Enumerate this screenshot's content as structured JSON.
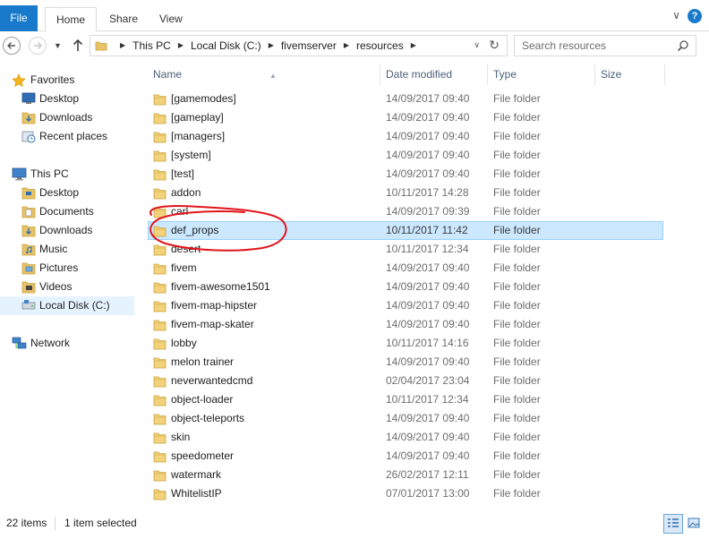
{
  "ribbon": {
    "tabs": [
      "File",
      "Home",
      "Share",
      "View"
    ],
    "minimize_glyph": "∨",
    "help_glyph": "?"
  },
  "address": {
    "breadcrumbs": [
      "This PC",
      "Local Disk (C:)",
      "fivemserver",
      "resources"
    ],
    "separator": "▶",
    "dropdown_glyph": "∨",
    "refresh_glyph": "↻",
    "recent_glyph": "▼"
  },
  "search": {
    "placeholder": "Search resources"
  },
  "navpane": {
    "favorites": {
      "label": "Favorites",
      "items": [
        "Desktop",
        "Downloads",
        "Recent places"
      ]
    },
    "thispc": {
      "label": "This PC",
      "items": [
        "Desktop",
        "Documents",
        "Downloads",
        "Music",
        "Pictures",
        "Videos",
        "Local Disk (C:)"
      ]
    },
    "network": {
      "label": "Network"
    }
  },
  "columns": {
    "name": "Name",
    "date": "Date modified",
    "type": "Type",
    "size": "Size",
    "sort_glyph": "▲"
  },
  "files": [
    {
      "name": "[gamemodes]",
      "date": "14/09/2017 09:40",
      "type": "File folder"
    },
    {
      "name": "[gameplay]",
      "date": "14/09/2017 09:40",
      "type": "File folder"
    },
    {
      "name": "[managers]",
      "date": "14/09/2017 09:40",
      "type": "File folder"
    },
    {
      "name": "[system]",
      "date": "14/09/2017 09:40",
      "type": "File folder"
    },
    {
      "name": "[test]",
      "date": "14/09/2017 09:40",
      "type": "File folder"
    },
    {
      "name": "addon",
      "date": "10/11/2017 14:28",
      "type": "File folder"
    },
    {
      "name": "carl",
      "date": "14/09/2017 09:39",
      "type": "File folder"
    },
    {
      "name": "def_props",
      "date": "10/11/2017 11:42",
      "type": "File folder",
      "selected": true
    },
    {
      "name": "desert",
      "date": "10/11/2017 12:34",
      "type": "File folder"
    },
    {
      "name": "fivem",
      "date": "14/09/2017 09:40",
      "type": "File folder"
    },
    {
      "name": "fivem-awesome1501",
      "date": "14/09/2017 09:40",
      "type": "File folder"
    },
    {
      "name": "fivem-map-hipster",
      "date": "14/09/2017 09:40",
      "type": "File folder"
    },
    {
      "name": "fivem-map-skater",
      "date": "14/09/2017 09:40",
      "type": "File folder"
    },
    {
      "name": "lobby",
      "date": "10/11/2017 14:16",
      "type": "File folder"
    },
    {
      "name": "melon trainer",
      "date": "14/09/2017 09:40",
      "type": "File folder"
    },
    {
      "name": "neverwantedcmd",
      "date": "02/04/2017 23:04",
      "type": "File folder"
    },
    {
      "name": "object-loader",
      "date": "10/11/2017 12:34",
      "type": "File folder"
    },
    {
      "name": "object-teleports",
      "date": "14/09/2017 09:40",
      "type": "File folder"
    },
    {
      "name": "skin",
      "date": "14/09/2017 09:40",
      "type": "File folder"
    },
    {
      "name": "speedometer",
      "date": "14/09/2017 09:40",
      "type": "File folder"
    },
    {
      "name": "watermark",
      "date": "26/02/2017 12:11",
      "type": "File folder"
    },
    {
      "name": "WhitelistIP",
      "date": "07/01/2017 13:00",
      "type": "File folder"
    }
  ],
  "status": {
    "item_count": "22 items",
    "selected": "1 item selected"
  },
  "colors": {
    "accent": "#1979ca",
    "selection": "#cce8ff",
    "selection_border": "#99d1ff",
    "folder": "#e8c266",
    "annotation": "#e0151d"
  }
}
